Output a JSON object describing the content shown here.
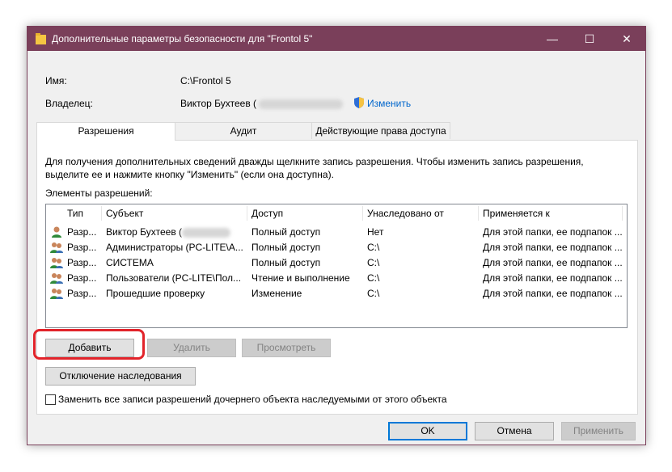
{
  "window": {
    "title": "Дополнительные параметры безопасности  для \"Frontol 5\""
  },
  "titlebar_buttons": {
    "minimize": "—",
    "maximize": "☐",
    "close": "✕"
  },
  "info": {
    "name_label": "Имя:",
    "name_value": "C:\\Frontol 5",
    "owner_label": "Владелец:",
    "owner_value": "Виктор Бухтеев (",
    "change_link": "Изменить"
  },
  "tabs": [
    "Разрешения",
    "Аудит",
    "Действующие права доступа"
  ],
  "description": "Для получения дополнительных сведений дважды щелкните запись разрешения. Чтобы изменить запись разрешения, выделите ее и нажмите кнопку \"Изменить\" (если она доступна).",
  "list_title": "Элементы разрешений:",
  "columns": [
    "Тип",
    "Субъект",
    "Доступ",
    "Унаследовано от",
    "Применяется к"
  ],
  "rows": [
    {
      "type": "Разр...",
      "subject": "Виктор Бухтеев (",
      "access": "Полный доступ",
      "inherited": "Нет",
      "applies": "Для этой папки, ее подпапок ..."
    },
    {
      "type": "Разр...",
      "subject": "Администраторы (PC-LITE\\A...",
      "access": "Полный доступ",
      "inherited": "C:\\",
      "applies": "Для этой папки, ее подпапок ..."
    },
    {
      "type": "Разр...",
      "subject": "СИСТЕМА",
      "access": "Полный доступ",
      "inherited": "C:\\",
      "applies": "Для этой папки, ее подпапок ..."
    },
    {
      "type": "Разр...",
      "subject": "Пользователи (PC-LITE\\Пол...",
      "access": "Чтение и выполнение",
      "inherited": "C:\\",
      "applies": "Для этой папки, ее подпапок ..."
    },
    {
      "type": "Разр...",
      "subject": "Прошедшие проверку",
      "access": "Изменение",
      "inherited": "C:\\",
      "applies": "Для этой папки, ее подпапок ..."
    }
  ],
  "buttons": {
    "add": "Добавить",
    "remove": "Удалить",
    "view": "Просмотреть",
    "disable_inheritance": "Отключение наследования",
    "ok": "OK",
    "cancel": "Отмена",
    "apply": "Применить"
  },
  "checkbox_label": "Заменить все записи разрешений дочернего объекта наследуемыми от этого объекта",
  "colors": {
    "titlebar": "#7a3f5a",
    "highlight": "#e2232a",
    "link": "#0066cc"
  }
}
